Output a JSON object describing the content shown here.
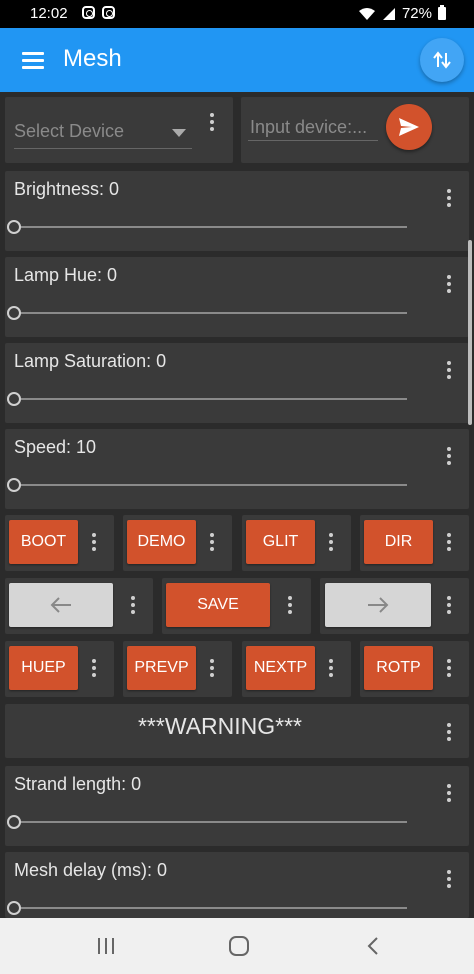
{
  "status": {
    "time": "12:02",
    "battery": "72%"
  },
  "app": {
    "title": "Mesh"
  },
  "select_device": {
    "placeholder": "Select Device"
  },
  "input_device": {
    "placeholder": "Input device:..."
  },
  "sliders": [
    {
      "label": "Brightness: 0",
      "value": 0
    },
    {
      "label": "Lamp Hue: 0",
      "value": 0
    },
    {
      "label": "Lamp Saturation: 0",
      "value": 0
    },
    {
      "label": "Speed: 10",
      "value": 0
    }
  ],
  "buttons_row1": [
    "BOOT",
    "DEMO",
    "GLIT",
    "DIR"
  ],
  "buttons_row2": {
    "left": "←",
    "save": "SAVE",
    "right": "→"
  },
  "buttons_row3": [
    "HUEP",
    "PREVP",
    "NEXTP",
    "ROTP"
  ],
  "warning": "***WARNING***",
  "sliders2": [
    {
      "label": "Strand length: 0",
      "value": 0
    },
    {
      "label": "Mesh delay (ms): 0",
      "value": 0
    }
  ],
  "colors": {
    "accent": "#2196f3",
    "button": "#d2522c",
    "card": "#3a3a3a",
    "background": "#2b2b2b"
  },
  "icons": {
    "menu": "hamburger-icon",
    "fab": "swap-vertical-icon",
    "send": "send-icon",
    "nav_recent": "recent-apps-icon",
    "nav_home": "home-icon",
    "nav_back": "back-icon"
  }
}
